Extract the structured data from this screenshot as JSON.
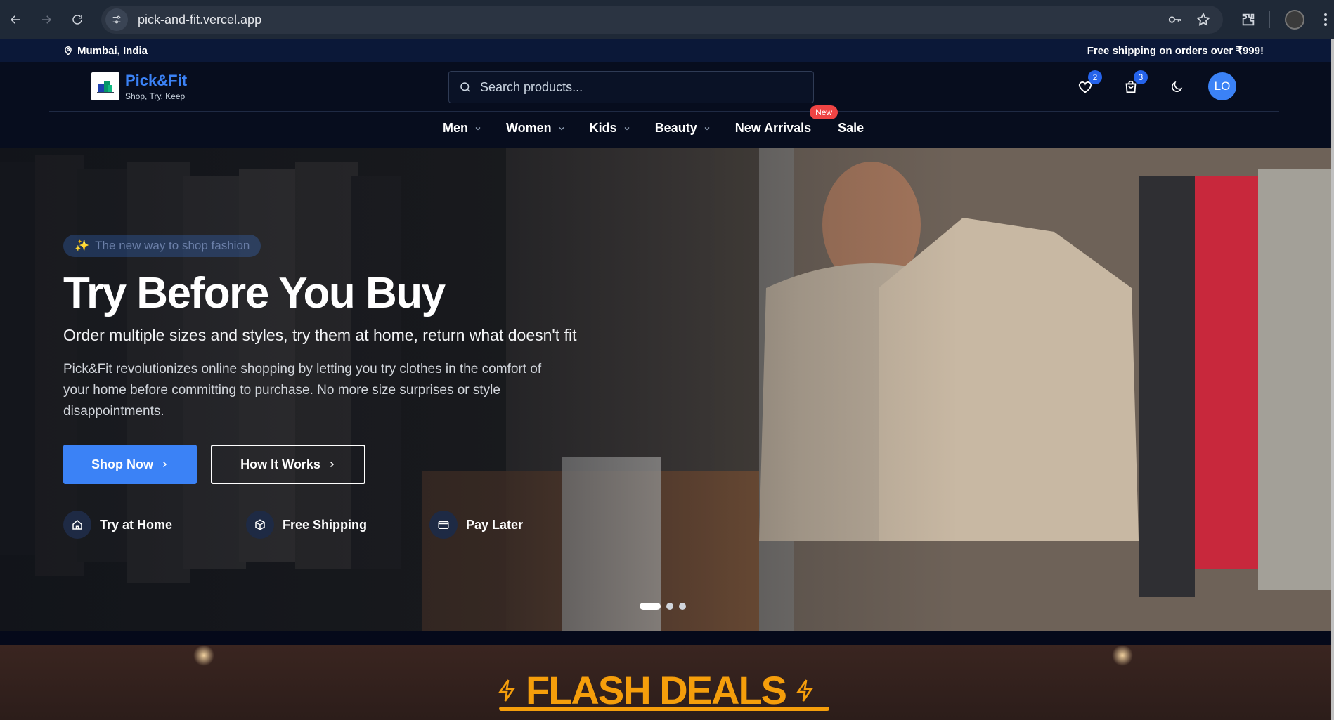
{
  "browser": {
    "url": "pick-and-fit.vercel.app"
  },
  "topbar": {
    "location": "Mumbai, India",
    "shipping_note": "Free shipping on orders over ₹999!"
  },
  "header": {
    "brand_name": "Pick&Fit",
    "brand_tagline": "Shop, Try, Keep",
    "search_placeholder": "Search products...",
    "wishlist_count": "2",
    "cart_count": "3",
    "avatar_initials": "LO"
  },
  "nav": {
    "items": [
      {
        "label": "Men"
      },
      {
        "label": "Women"
      },
      {
        "label": "Kids"
      },
      {
        "label": "Beauty"
      },
      {
        "label": "New Arrivals",
        "badge": "New"
      },
      {
        "label": "Sale"
      }
    ]
  },
  "hero": {
    "pill": "The new way to shop fashion",
    "title": "Try Before You Buy",
    "subtitle": "Order multiple sizes and styles, try them at home, return what doesn't fit",
    "description": "Pick&Fit revolutionizes online shopping by letting you try clothes in the comfort of your home before committing to purchase. No more size surprises or style disappointments.",
    "primary_button": "Shop Now",
    "secondary_button": "How It Works",
    "features": [
      {
        "label": "Try at Home",
        "icon": "home-icon"
      },
      {
        "label": "Free Shipping",
        "icon": "package-icon"
      },
      {
        "label": "Pay Later",
        "icon": "card-icon"
      }
    ],
    "slides_total": 3,
    "active_slide": 1
  },
  "flash_deals": {
    "title": "FLASH DEALS"
  },
  "colors": {
    "accent": "#3b82f6",
    "flash": "#f59e0b",
    "badge_red": "#ef4444"
  }
}
